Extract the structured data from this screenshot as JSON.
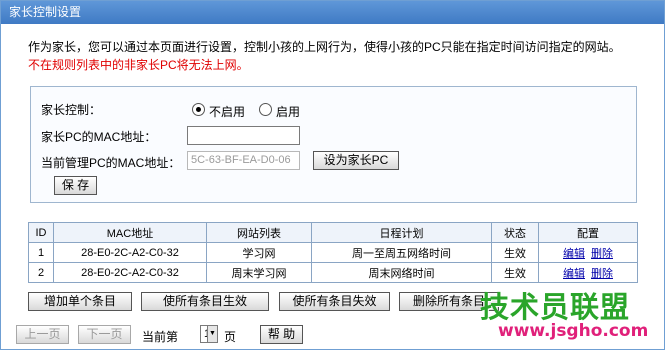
{
  "title": "家长控制设置",
  "intro": {
    "line1": "作为家长，您可以通过本页面进行设置，控制小孩的上网行为，使得小孩的PC只能在指定时间访问指定的网站。",
    "line2": "不在规则列表中的非家长PC将无法上网。"
  },
  "form": {
    "control_label": "家长控制：",
    "control_options": [
      "不启用",
      "启用"
    ],
    "control_selected": "不启用",
    "parent_mac_label": "家长PC的MAC地址：",
    "parent_mac_value": "",
    "current_mac_label": "当前管理PC的MAC地址：",
    "current_mac_value": "5C-63-BF-EA-D0-06",
    "set_parent_button": "设为家长PC",
    "save_button": "保 存"
  },
  "table": {
    "headers": [
      "ID",
      "MAC地址",
      "网站列表",
      "日程计划",
      "状态",
      "配置"
    ],
    "rows": [
      {
        "id": "1",
        "mac": "28-E0-2C-A2-C0-32",
        "site_list": "学习网",
        "schedule": "周一至周五网络时间",
        "status": "生效",
        "edit": "编辑",
        "delete": "删除"
      },
      {
        "id": "2",
        "mac": "28-E0-2C-A2-C0-32",
        "site_list": "周末学习网",
        "schedule": "周末网络时间",
        "status": "生效",
        "edit": "编辑",
        "delete": "删除"
      }
    ]
  },
  "actions": {
    "add": "增加单个条目",
    "enable_all": "使所有条目生效",
    "disable_all": "使所有条目失效",
    "delete_all": "删除所有条目"
  },
  "pager": {
    "prev": "上一页",
    "next": "下一页",
    "current_label": "当前第",
    "page": "1",
    "page_unit": "页",
    "help": "帮 助"
  },
  "watermark": {
    "brand": "技术员联盟",
    "url": "www.jsgho.com"
  }
}
